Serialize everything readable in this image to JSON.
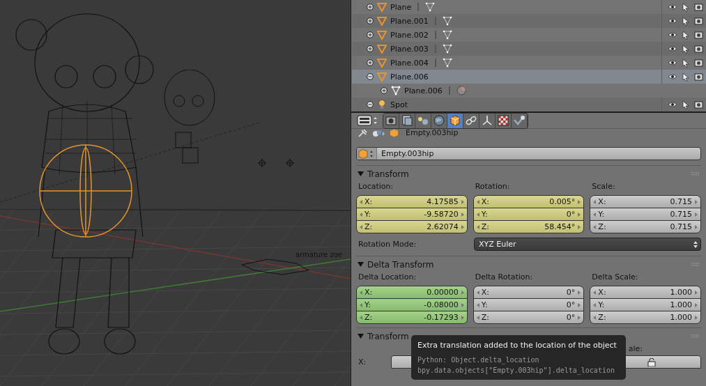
{
  "viewport": {
    "object_label": "armature zoe"
  },
  "outliner": {
    "items": [
      {
        "name": "Plane",
        "kind": "mesh",
        "expanded": false,
        "selected": false
      },
      {
        "name": "Plane.001",
        "kind": "mesh",
        "expanded": false,
        "selected": false
      },
      {
        "name": "Plane.002",
        "kind": "mesh",
        "expanded": false,
        "selected": false
      },
      {
        "name": "Plane.003",
        "kind": "mesh",
        "expanded": false,
        "selected": false
      },
      {
        "name": "Plane.004",
        "kind": "mesh",
        "expanded": false,
        "selected": false
      },
      {
        "name": "Plane.006",
        "kind": "mesh",
        "expanded": true,
        "selected": true,
        "children": [
          {
            "name": "Plane.006",
            "kind": "mesh-data"
          }
        ]
      },
      {
        "name": "Spot",
        "kind": "lamp",
        "expanded": true,
        "selected": false
      }
    ]
  },
  "properties": {
    "tabs": [
      {
        "kind": "render",
        "selected": false
      },
      {
        "kind": "layers",
        "selected": false
      },
      {
        "kind": "scene",
        "selected": false
      },
      {
        "kind": "world",
        "selected": false
      },
      {
        "kind": "object",
        "selected": true
      },
      {
        "kind": "constraints",
        "selected": false
      },
      {
        "kind": "data",
        "selected": false
      },
      {
        "kind": "texture",
        "selected": false
      },
      {
        "kind": "physics",
        "selected": false
      }
    ],
    "breadcrumb": "Empty.003hip",
    "object_name": "Empty.003hip",
    "panels": [
      {
        "title": "Transform",
        "expanded": true,
        "groups": [
          {
            "label": "Location:",
            "keyframed": true,
            "animated": true,
            "fields": [
              {
                "axis": "X:",
                "value": "4.17585"
              },
              {
                "axis": "Y:",
                "value": "-9.58720"
              },
              {
                "axis": "Z:",
                "value": "2.62074"
              }
            ]
          },
          {
            "label": "Rotation:",
            "keyframed": true,
            "animated": true,
            "fields": [
              {
                "axis": "X:",
                "value": "0.005°"
              },
              {
                "axis": "Y:",
                "value": "0°"
              },
              {
                "axis": "Z:",
                "value": "58.454°"
              }
            ]
          },
          {
            "label": "Scale:",
            "keyframed": false,
            "animated": false,
            "fields": [
              {
                "axis": "X:",
                "value": "0.715"
              },
              {
                "axis": "Y:",
                "value": "0.715"
              },
              {
                "axis": "Z:",
                "value": "0.715"
              }
            ]
          }
        ],
        "mode_label": "Rotation Mode:",
        "mode_value": "XYZ Euler"
      },
      {
        "title": "Delta Transform",
        "expanded": true,
        "groups": [
          {
            "label": "Delta Location:",
            "keyframed": false,
            "animated": true,
            "fields": [
              {
                "axis": "X:",
                "value": "0.00000"
              },
              {
                "axis": "Y:",
                "value": "-0.08000"
              },
              {
                "axis": "Z:",
                "value": "-0.17293"
              }
            ]
          },
          {
            "label": "Delta Rotation:",
            "keyframed": false,
            "animated": false,
            "fields": [
              {
                "axis": "X:",
                "value": "0°"
              },
              {
                "axis": "Y:",
                "value": "0°"
              },
              {
                "axis": "Z:",
                "value": "0°"
              }
            ]
          },
          {
            "label": "Delta Scale:",
            "keyframed": false,
            "animated": false,
            "fields": [
              {
                "axis": "X:",
                "value": "1.000"
              },
              {
                "axis": "Y:",
                "value": "1.000"
              },
              {
                "axis": "Z:",
                "value": "1.000"
              }
            ]
          }
        ]
      }
    ],
    "locks_panel": {
      "title": "Transform",
      "scale_label": "ale:",
      "row_label": "X:"
    },
    "tooltip": {
      "text": "Extra translation added to the location of the object",
      "python": [
        "Python: Object.delta_location",
        "bpy.data.objects[\"Empty.003hip\"].delta_location"
      ]
    }
  }
}
